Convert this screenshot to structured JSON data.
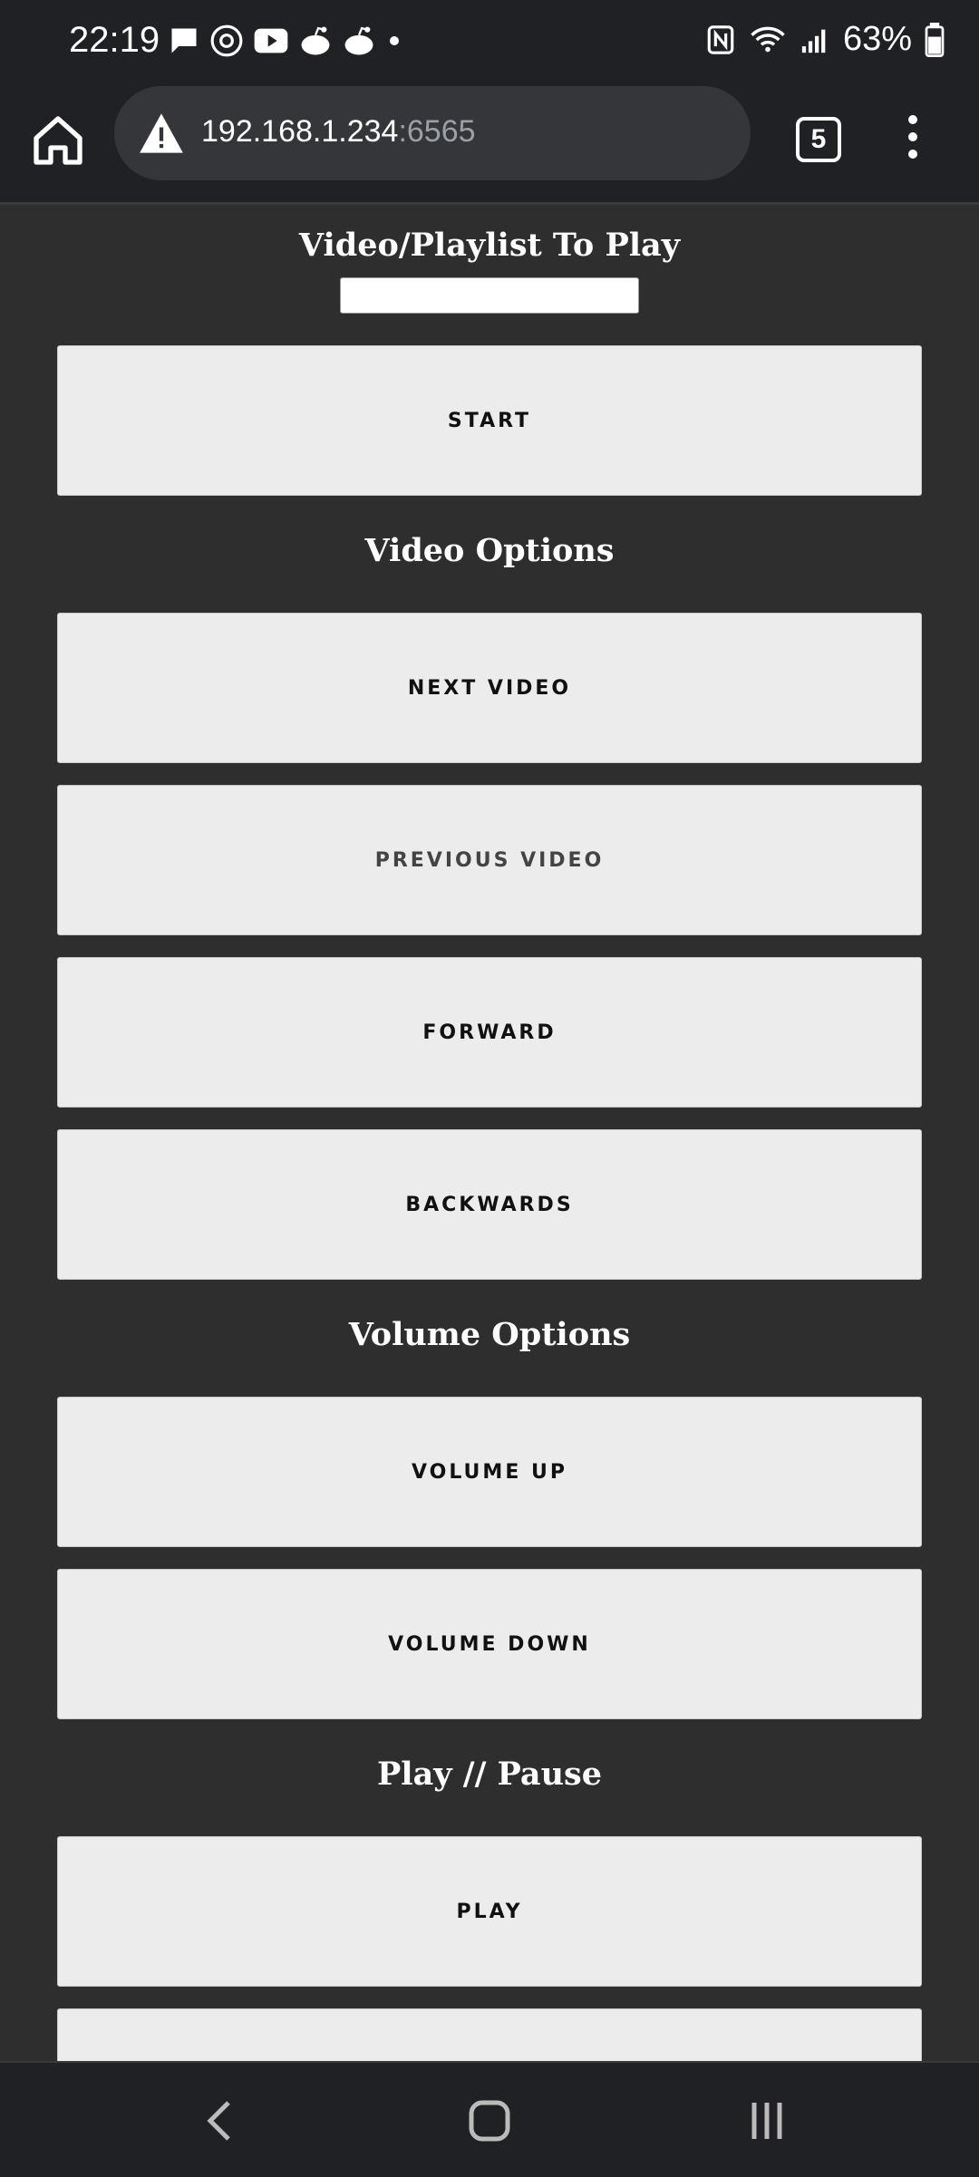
{
  "status_bar": {
    "time": "22:19",
    "battery_percent": "63%",
    "left_icons": [
      "message-icon",
      "threads-icon",
      "youtube-icon",
      "reddit-icon",
      "reddit-icon",
      "dot-icon"
    ],
    "right_icons": [
      "nfc-icon",
      "wifi-icon",
      "signal-icon",
      "battery-icon"
    ]
  },
  "browser": {
    "url_host": "192.168.1.234",
    "url_port": ":6565",
    "tab_count": "5",
    "security_icon": "warning-icon"
  },
  "page": {
    "play_heading": "Video/Playlist To Play",
    "play_input_value": "",
    "start_label": "START",
    "video_heading": "Video Options",
    "next_label": "NEXT VIDEO",
    "previous_label": "PREVIOUS VIDEO",
    "forward_label": "FORWARD",
    "backwards_label": "BACKWARDS",
    "volume_heading": "Volume Options",
    "volume_up_label": "VOLUME UP",
    "volume_down_label": "VOLUME DOWN",
    "playpause_heading": "Play // Pause",
    "play_label": "PLAY"
  },
  "colors": {
    "page_bg": "#2e2e2e",
    "chrome_bg": "#202124",
    "button_bg": "#ececec"
  }
}
